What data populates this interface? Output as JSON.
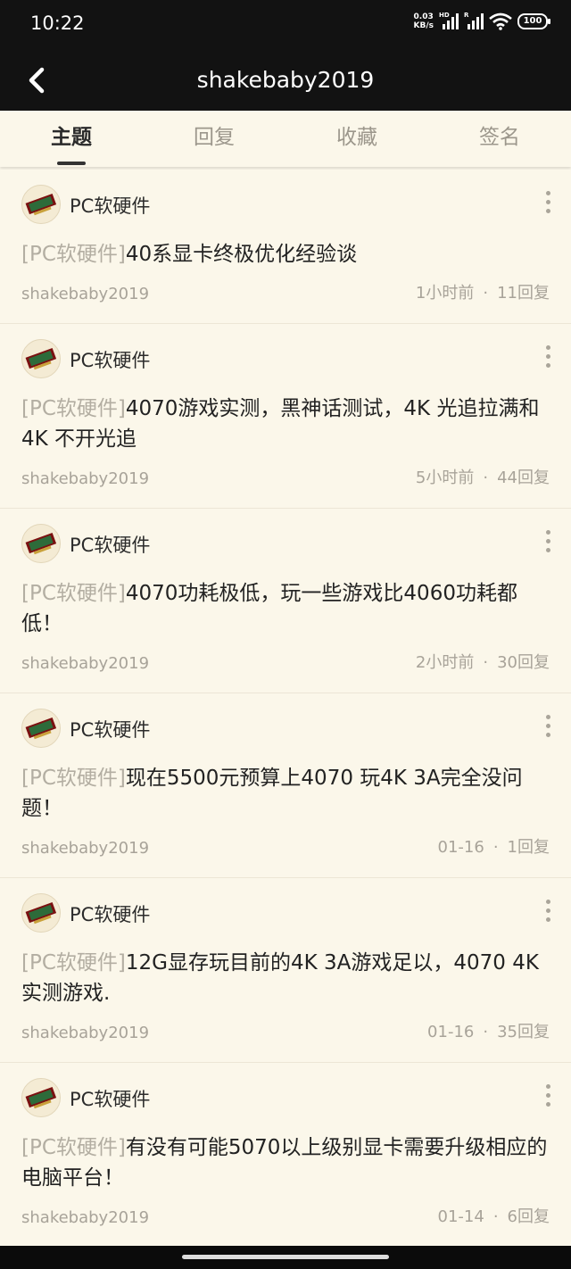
{
  "status": {
    "time": "10:22",
    "net_speed_value": "0.03",
    "net_speed_unit": "KB/s",
    "sig1_tag": "HD",
    "sig2_tag": "R",
    "battery": "100"
  },
  "header": {
    "title": "shakebaby2019",
    "back_icon": "back-arrow-icon"
  },
  "tabs": [
    {
      "label": "主题",
      "active": true
    },
    {
      "label": "回复",
      "active": false
    },
    {
      "label": "收藏",
      "active": false
    },
    {
      "label": "签名",
      "active": false
    }
  ],
  "posts": [
    {
      "forum": "PC软硬件",
      "tag": "[PC软硬件]",
      "title": "40系显卡终极优化经验谈",
      "author": "shakebaby2019",
      "time": "1小时前",
      "dot": "·",
      "replies": "11回复"
    },
    {
      "forum": "PC软硬件",
      "tag": "[PC软硬件]",
      "title": "4070游戏实测，黑神话测试，4K 光追拉满和4K 不开光追",
      "author": "shakebaby2019",
      "time": "5小时前",
      "dot": "·",
      "replies": "44回复"
    },
    {
      "forum": "PC软硬件",
      "tag": "[PC软硬件]",
      "title": "4070功耗极低，玩一些游戏比4060功耗都低！",
      "author": "shakebaby2019",
      "time": "2小时前",
      "dot": "·",
      "replies": "30回复"
    },
    {
      "forum": "PC软硬件",
      "tag": "[PC软硬件]",
      "title": "现在5500元预算上4070 玩4K 3A完全没问题！",
      "author": "shakebaby2019",
      "time": "01-16",
      "dot": "·",
      "replies": "1回复"
    },
    {
      "forum": "PC软硬件",
      "tag": "[PC软硬件]",
      "title": "12G显存玩目前的4K 3A游戏足以，4070 4K实测游戏.",
      "author": "shakebaby2019",
      "time": "01-16",
      "dot": "·",
      "replies": "35回复"
    },
    {
      "forum": "PC软硬件",
      "tag": "[PC软硬件]",
      "title": "有没有可能5070以上级别显卡需要升级相应的电脑平台！",
      "author": "shakebaby2019",
      "time": "01-14",
      "dot": "·",
      "replies": "6回复"
    }
  ],
  "colors": {
    "header_bg": "#121212",
    "page_bg": "#fbf7ea",
    "tag_gray": "#b3aea2",
    "meta_gray": "#a8a399"
  }
}
